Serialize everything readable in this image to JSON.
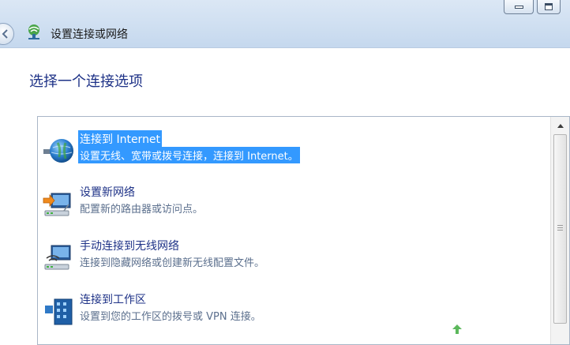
{
  "window": {
    "title": "设置连接或网络",
    "controls": [
      "minimize",
      "maximize"
    ]
  },
  "heading": "选择一个连接选项",
  "options": [
    {
      "title": "连接到 Internet",
      "description": "设置无线、宽带或拨号连接，连接到 Internet。",
      "icon": "globe-network-icon",
      "selected": true
    },
    {
      "title": "设置新网络",
      "description": "配置新的路由器或访问点。",
      "icon": "new-network-router-icon",
      "selected": false
    },
    {
      "title": "手动连接到无线网络",
      "description": "连接到隐藏网络或创建新无线配置文件。",
      "icon": "wireless-network-icon",
      "selected": false
    },
    {
      "title": "连接到工作区",
      "description": "设置到您的工作区的拨号或 VPN 连接。",
      "icon": "workplace-vpn-icon",
      "selected": false
    }
  ],
  "colors": {
    "selection": "#3399ff",
    "heading": "#1e3287",
    "description": "#5b6f8d",
    "titlebar": "#cfdff1"
  }
}
